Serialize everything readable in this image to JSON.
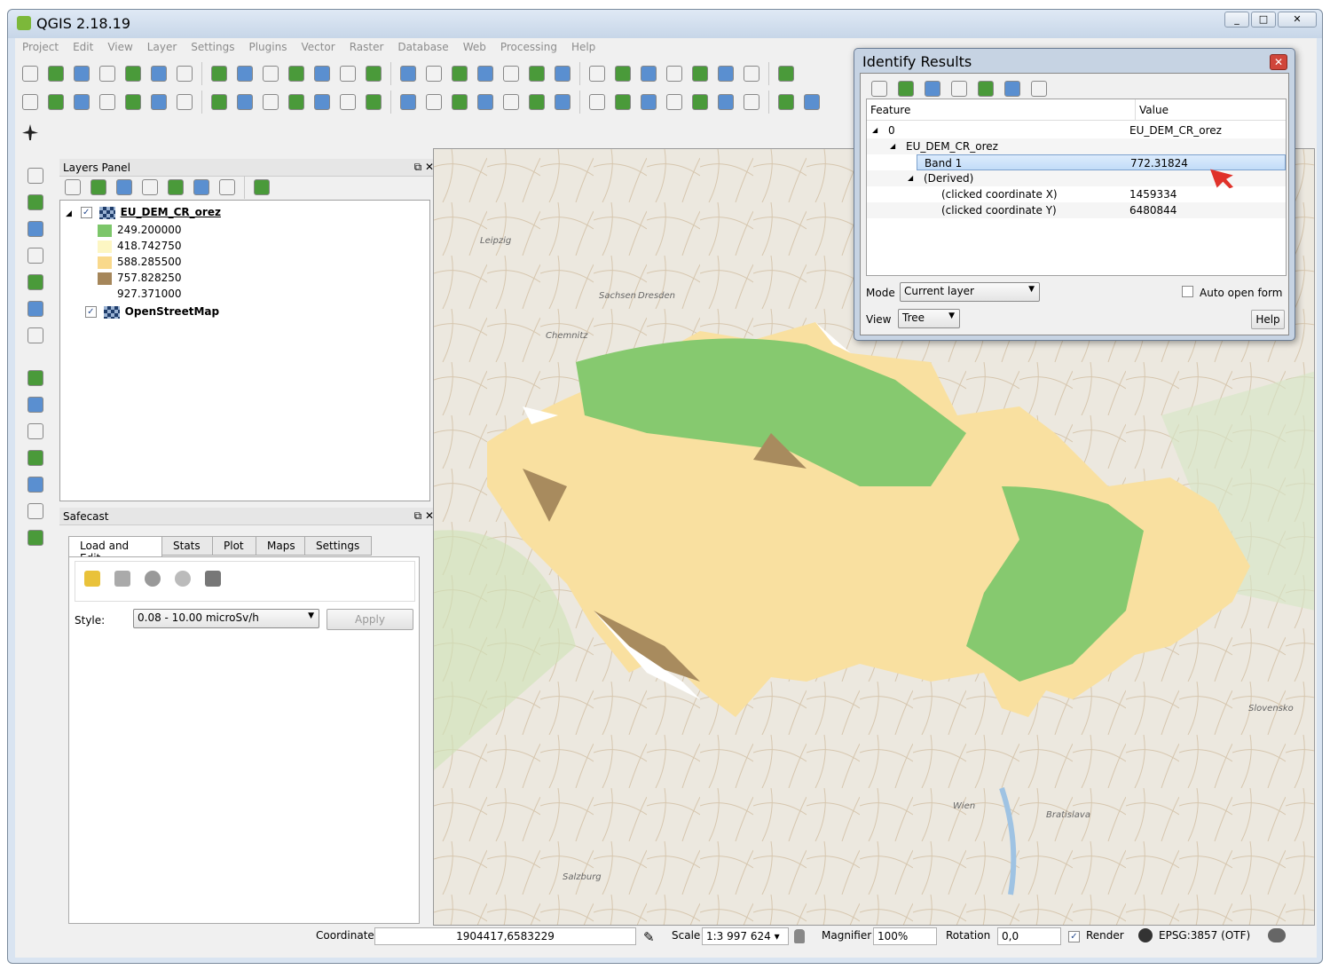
{
  "window": {
    "title": "QGIS 2.18.19"
  },
  "menu": [
    "Project",
    "Edit",
    "View",
    "Layer",
    "Settings",
    "Plugins",
    "Vector",
    "Raster",
    "Database",
    "Web",
    "Processing",
    "Help"
  ],
  "layers_panel": {
    "title": "Layers Panel",
    "layers": [
      {
        "name": "EU_DEM_CR_orez",
        "checked": true,
        "legend": [
          {
            "label": "249.200000",
            "color": "#7cc66a"
          },
          {
            "label": "418.742750",
            "color": "#fdf6c3"
          },
          {
            "label": "588.285500",
            "color": "#f9d98c"
          },
          {
            "label": "757.828250",
            "color": "#a5865a"
          },
          {
            "label": "927.371000",
            "color": "#ffffff"
          }
        ]
      },
      {
        "name": "OpenStreetMap",
        "checked": true
      }
    ]
  },
  "safecast": {
    "title": "Safecast",
    "tabs": [
      "Load and Edit",
      "Stats",
      "Plot",
      "Maps",
      "Settings"
    ],
    "active_tab": "Load and Edit",
    "style_label": "Style:",
    "style_value": "0.08 - 10.00 microSv/h",
    "apply": "Apply"
  },
  "identify": {
    "title": "Identify Results",
    "columns": [
      "Feature",
      "Value"
    ],
    "rows": [
      {
        "feature": "0",
        "value": "EU_DEM_CR_orez",
        "level": 0,
        "expander": true
      },
      {
        "feature": "EU_DEM_CR_orez",
        "value": "",
        "level": 1,
        "expander": true
      },
      {
        "feature": "Band 1",
        "value": "772.31824",
        "level": 2,
        "selected": true
      },
      {
        "feature": "(Derived)",
        "value": "",
        "level": 2,
        "expander": true
      },
      {
        "feature": "(clicked coordinate X)",
        "value": "1459334",
        "level": 3
      },
      {
        "feature": "(clicked coordinate Y)",
        "value": "6480844",
        "level": 3
      }
    ],
    "mode_label": "Mode",
    "mode_value": "Current layer",
    "auto_open_form": "Auto open form",
    "auto_open_checked": false,
    "view_label": "View",
    "view_value": "Tree",
    "help": "Help"
  },
  "map_labels": [
    "Dresden",
    "Leipzig",
    "Chemnitz",
    "Sachsen",
    "Wien",
    "Bratislava",
    "Slovensko",
    "Salzburg"
  ],
  "status": {
    "coordinate_label": "Coordinate",
    "coordinate": "1904417,6583229",
    "scale_label": "Scale",
    "scale": "1:3 997 624",
    "magnifier_label": "Magnifier",
    "magnifier": "100%",
    "rotation_label": "Rotation",
    "rotation": "0,0",
    "render_label": "Render",
    "render_checked": true,
    "crs": "EPSG:3857 (OTF)"
  }
}
